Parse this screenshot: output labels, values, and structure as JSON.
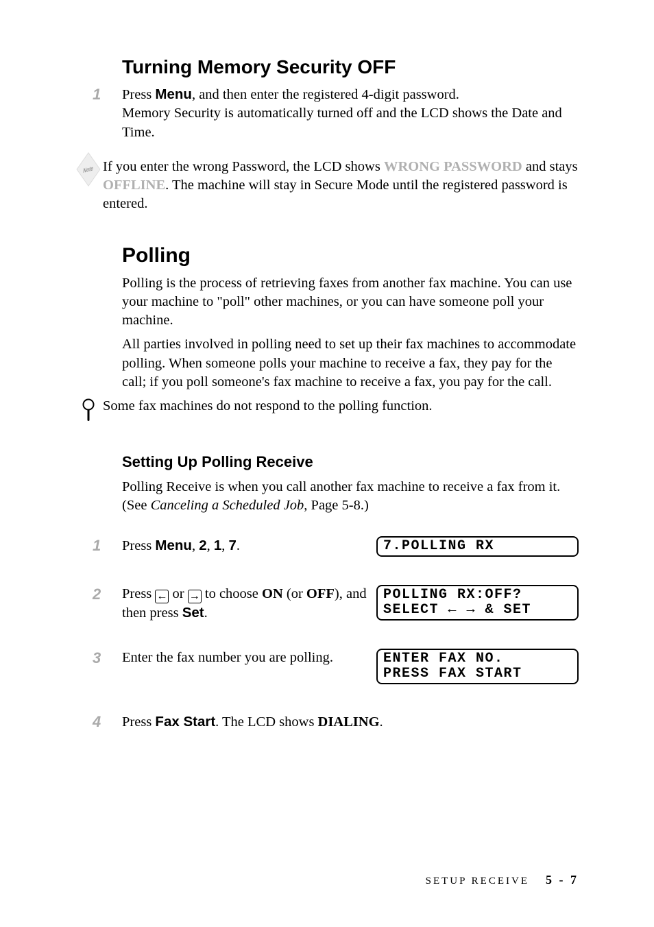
{
  "h2_security": "Turning Memory Security OFF",
  "security_step1": {
    "num": "1",
    "line1_a": "Press ",
    "menu_label": "Menu",
    "line1_b": ", and then enter the registered 4-digit password.",
    "line2": "Memory Security is automatically turned off and the LCD shows the Date and Time."
  },
  "note_icon_label": "Note",
  "security_note": {
    "a": "If you enter the wrong Password, the LCD shows ",
    "wrong_password": "WRONG PASSWORD",
    "b": " and stays ",
    "offline": "OFFLINE",
    "c": ". The machine will stay in Secure Mode until the registered password is entered."
  },
  "h2_polling": "Polling",
  "polling_p1": "Polling is the process of retrieving faxes from another fax machine.  You can use your machine to \"poll\" other machines, or you can have someone poll your machine.",
  "polling_p2": "All parties involved in polling need to set up their fax machines to accommodate polling.  When someone polls your machine to receive a fax, they pay for the call; if you poll someone's fax machine to receive a fax, you pay for the call.",
  "polling_tip": "Some fax machines do not respond to the polling function.",
  "h3_setup": "Setting Up Polling Receive",
  "setup_p1_a": "Polling Receive is when you call another fax machine to receive a fax from it. (See ",
  "setup_p1_i": "Canceling a Scheduled Job",
  "setup_p1_b": ", Page 5-8.)",
  "steps": {
    "s1": {
      "num": "1",
      "a": "Press ",
      "menu": "Menu",
      "b": ", ",
      "k1": "2",
      "c": ", ",
      "k2": "1",
      "d": ", ",
      "k3": "7",
      "e": "."
    },
    "s2": {
      "num": "2",
      "a": "Press ",
      "b": " or ",
      "c": " to choose ",
      "on": "ON",
      "d": " (or ",
      "off": "OFF",
      "e": "), and then press ",
      "set": "Set",
      "f": "."
    },
    "s3": {
      "num": "3",
      "text": "Enter the fax number you are polling."
    },
    "s4": {
      "num": "4",
      "a": "Press ",
      "fax_start": "Fax Start",
      "b": ". The LCD shows ",
      "dialing": "DIALING",
      "c": "."
    }
  },
  "lcd1": "7.POLLING RX",
  "lcd2": "POLLING RX:OFF?\nSELECT ← → & SET",
  "lcd3": "ENTER FAX NO.\nPRESS FAX START",
  "footer_section": "SETUP RECEIVE",
  "footer_page": "5 - 7"
}
